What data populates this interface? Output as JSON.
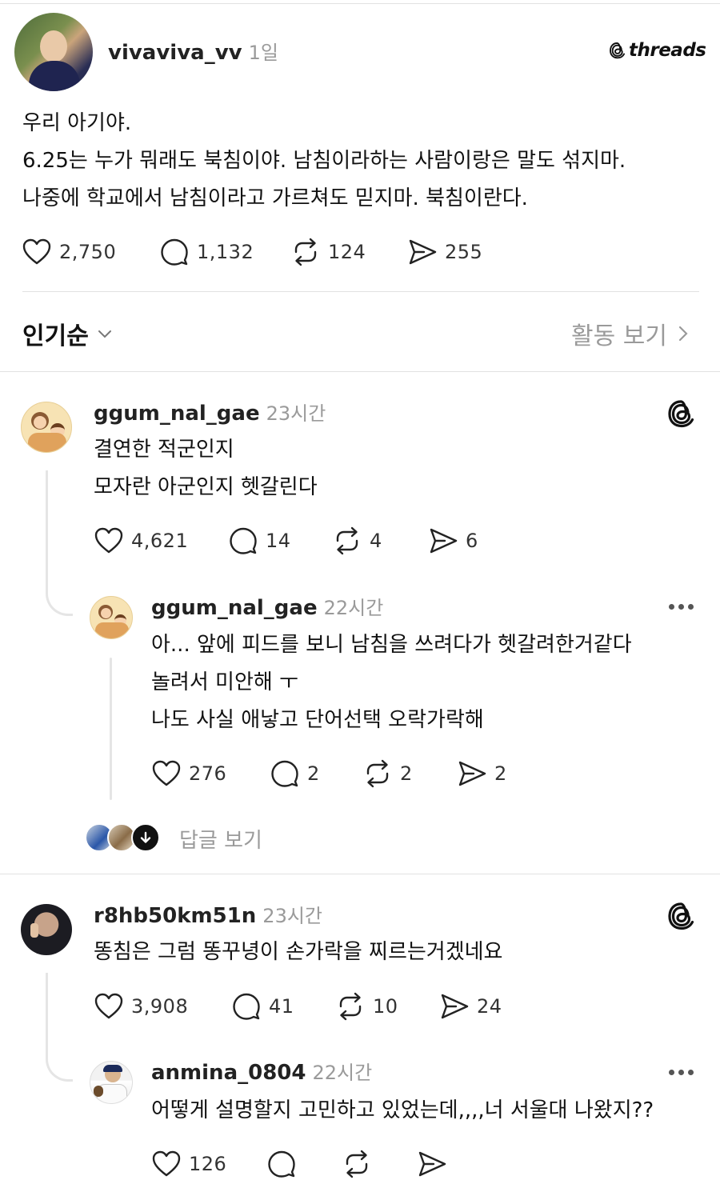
{
  "post": {
    "username": "vivaviva_vv",
    "time": "1일",
    "brand": "threads",
    "lines": [
      "우리 아기야.",
      "6.25는 누가 뭐래도 북침이야. 남침이라하는 사람이랑은 말도 섞지마.",
      "나중에 학교에서 남침이라고 가르쳐도 믿지마. 북침이란다."
    ],
    "likes": "2,750",
    "comments": "1,132",
    "reposts": "124",
    "shares": "255"
  },
  "sort": {
    "label": "인기순",
    "activity_label": "활동 보기"
  },
  "replies": [
    {
      "username": "ggum_nal_gae",
      "time": "23시간",
      "lines": [
        "결연한 적군인지",
        "모자란 아군인지 헷갈린다"
      ],
      "likes": "4,621",
      "comments": "14",
      "reposts": "4",
      "shares": "6",
      "nested": {
        "username": "ggum_nal_gae",
        "time": "22시간",
        "lines": [
          "아... 앞에 피드를 보니 남침을 쓰려다가 헷갈려한거같다",
          "놀려서 미안해 ㅜ",
          "나도 사실 애낳고 단어선택 오락가락해"
        ],
        "likes": "276",
        "comments": "2",
        "reposts": "2",
        "shares": "2"
      },
      "view_replies_label": "답글 보기"
    },
    {
      "username": "r8hb50km51n",
      "time": "23시간",
      "lines": [
        "똥침은 그럼 똥꾸녕이 손가락을 찌르는거겠네요"
      ],
      "likes": "3,908",
      "comments": "41",
      "reposts": "10",
      "shares": "24",
      "nested": {
        "username": "anmina_0804",
        "time": "22시간",
        "lines": [
          "어떻게 설명할지 고민하고 있었는데,,,,너 서울대 나왔지??"
        ],
        "likes": "126"
      }
    }
  ],
  "icons": {
    "like": "heart-icon",
    "comment": "comment-bubble-icon",
    "repost": "repost-icon",
    "share": "send-icon",
    "more": "more-horizontal-icon",
    "threads": "threads-logo-icon",
    "chevron_down": "chevron-down-icon",
    "chevron_right": "chevron-right-icon",
    "arrow_down": "arrow-down-icon"
  },
  "colors": {
    "text": "#111111",
    "muted": "#9a9a9a",
    "divider": "#e2e2e2"
  }
}
